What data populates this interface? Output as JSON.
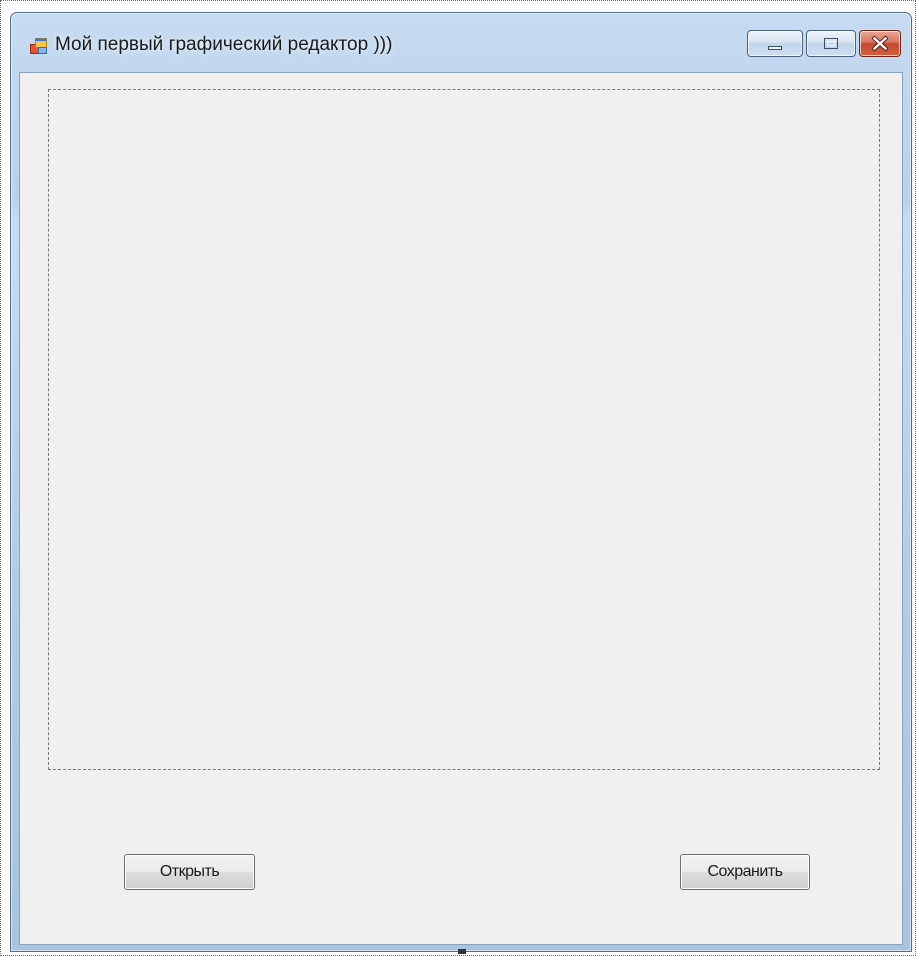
{
  "window": {
    "title": "Мой первый графический редактор )))",
    "icons": {
      "app": "form-app-icon",
      "minimize": "minimize-icon",
      "maximize": "maximize-icon",
      "close": "close-icon"
    }
  },
  "canvas": {
    "name": "picture-box"
  },
  "buttons": {
    "open_label": "Открыть",
    "save_label": "Сохранить"
  },
  "colors": {
    "client_background": "#f0f0f0",
    "close_button": "#c5482f",
    "frame": "#b3cce6"
  }
}
